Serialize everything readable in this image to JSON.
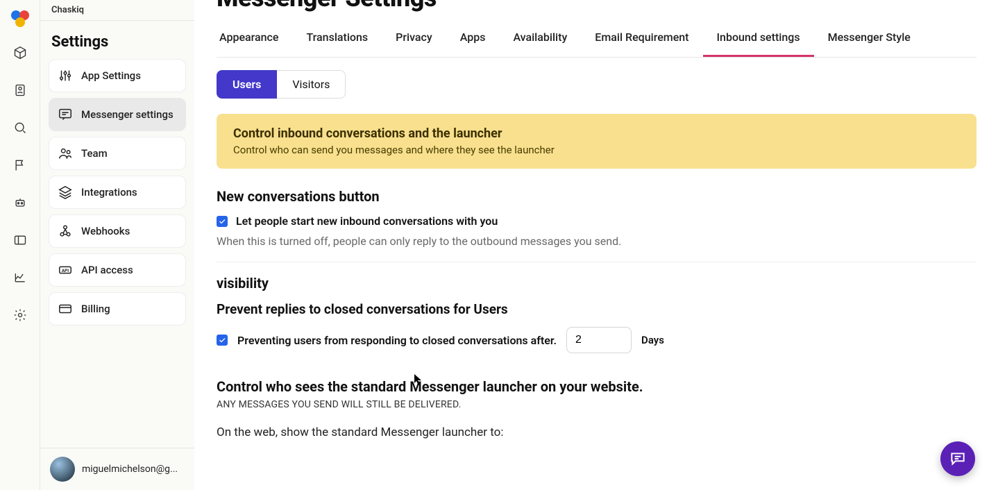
{
  "brand": "Chaskiq",
  "sidebar": {
    "title": "Settings",
    "items": [
      {
        "label": "App Settings"
      },
      {
        "label": "Messenger settings"
      },
      {
        "label": "Team"
      },
      {
        "label": "Integrations"
      },
      {
        "label": "Webhooks"
      },
      {
        "label": "API access"
      },
      {
        "label": "Billing"
      }
    ],
    "active_index": 1,
    "user_email": "miguelmichelson@g..."
  },
  "page": {
    "title": "Messenger Settings",
    "tabs": [
      "Appearance",
      "Translations",
      "Privacy",
      "Apps",
      "Availability",
      "Email Requirement",
      "Inbound settings",
      "Messenger Style"
    ],
    "active_tab_index": 6,
    "subtabs": [
      "Users",
      "Visitors"
    ],
    "active_subtab_index": 0,
    "banner": {
      "title": "Control inbound conversations and the launcher",
      "sub": "Control who can send you messages and where they see the launcher"
    },
    "new_conv": {
      "heading": "New conversations button",
      "check_label": "Let people start new inbound conversations with you",
      "checked": true,
      "help": "When this is turned off, people can only reply to the outbound messages you send."
    },
    "visibility_heading": "visibility",
    "prevent": {
      "heading": "Prevent replies to closed conversations for Users",
      "check_label": "Preventing users from responding to closed conversations after.",
      "checked": true,
      "days_value": "2",
      "days_label": "Days"
    },
    "launcher": {
      "heading": "Control who sees the standard Messenger launcher on your website.",
      "sub": "ANY MESSAGES YOU SEND WILL STILL BE DELIVERED.",
      "question": "On the web, show the standard Messenger launcher to:"
    }
  }
}
